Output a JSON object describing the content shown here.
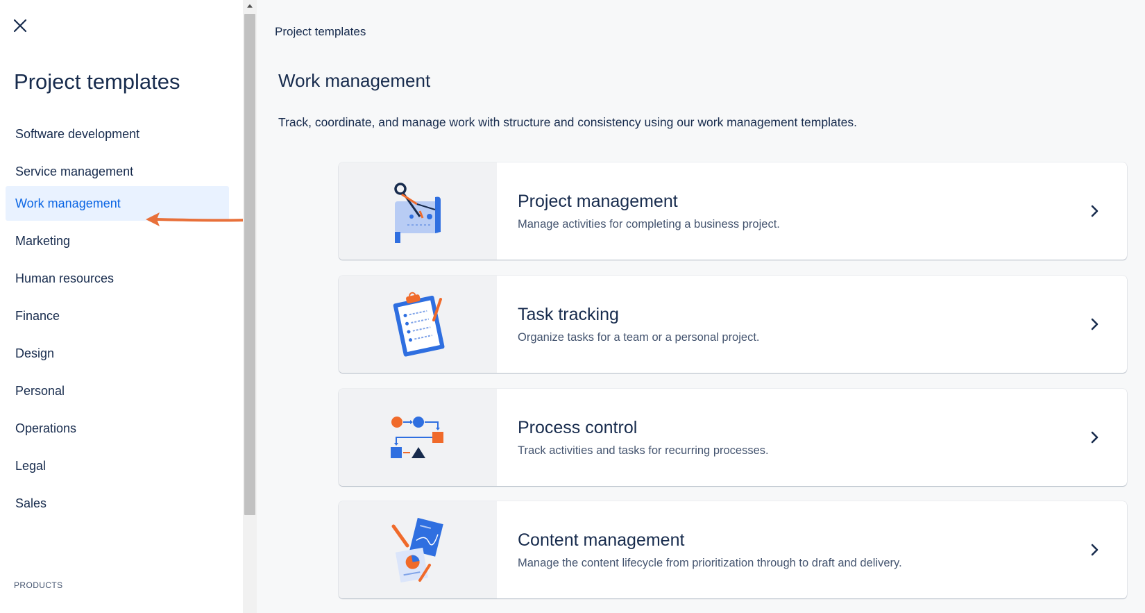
{
  "sidebar": {
    "title": "Project templates",
    "items": [
      {
        "label": "Software development"
      },
      {
        "label": "Service management"
      },
      {
        "label": "Work management",
        "active": true
      },
      {
        "label": "Marketing"
      },
      {
        "label": "Human resources"
      },
      {
        "label": "Finance"
      },
      {
        "label": "Design"
      },
      {
        "label": "Personal"
      },
      {
        "label": "Operations"
      },
      {
        "label": "Legal"
      },
      {
        "label": "Sales"
      }
    ],
    "section_label": "PRODUCTS"
  },
  "main": {
    "breadcrumb": "Project templates",
    "title": "Work management",
    "description": "Track, coordinate, and manage work with structure and consistency using our work management templates.",
    "cards": [
      {
        "title": "Project management",
        "description": "Manage activities for completing a business project.",
        "icon": "blueprint-compass-icon"
      },
      {
        "title": "Task tracking",
        "description": "Organize tasks for a team or a personal project.",
        "icon": "clipboard-checklist-icon"
      },
      {
        "title": "Process control",
        "description": "Track activities and tasks for recurring processes.",
        "icon": "process-flow-icon"
      },
      {
        "title": "Content management",
        "description": "Manage the content lifecycle from prioritization through to draft and delivery.",
        "icon": "content-documents-icon"
      }
    ]
  },
  "colors": {
    "accent": "#0c66e4",
    "active_bg": "#e9f2ff",
    "annotation_arrow": "#e8703a",
    "icon_blue": "#2f6fe0",
    "icon_orange": "#f06a2a"
  }
}
